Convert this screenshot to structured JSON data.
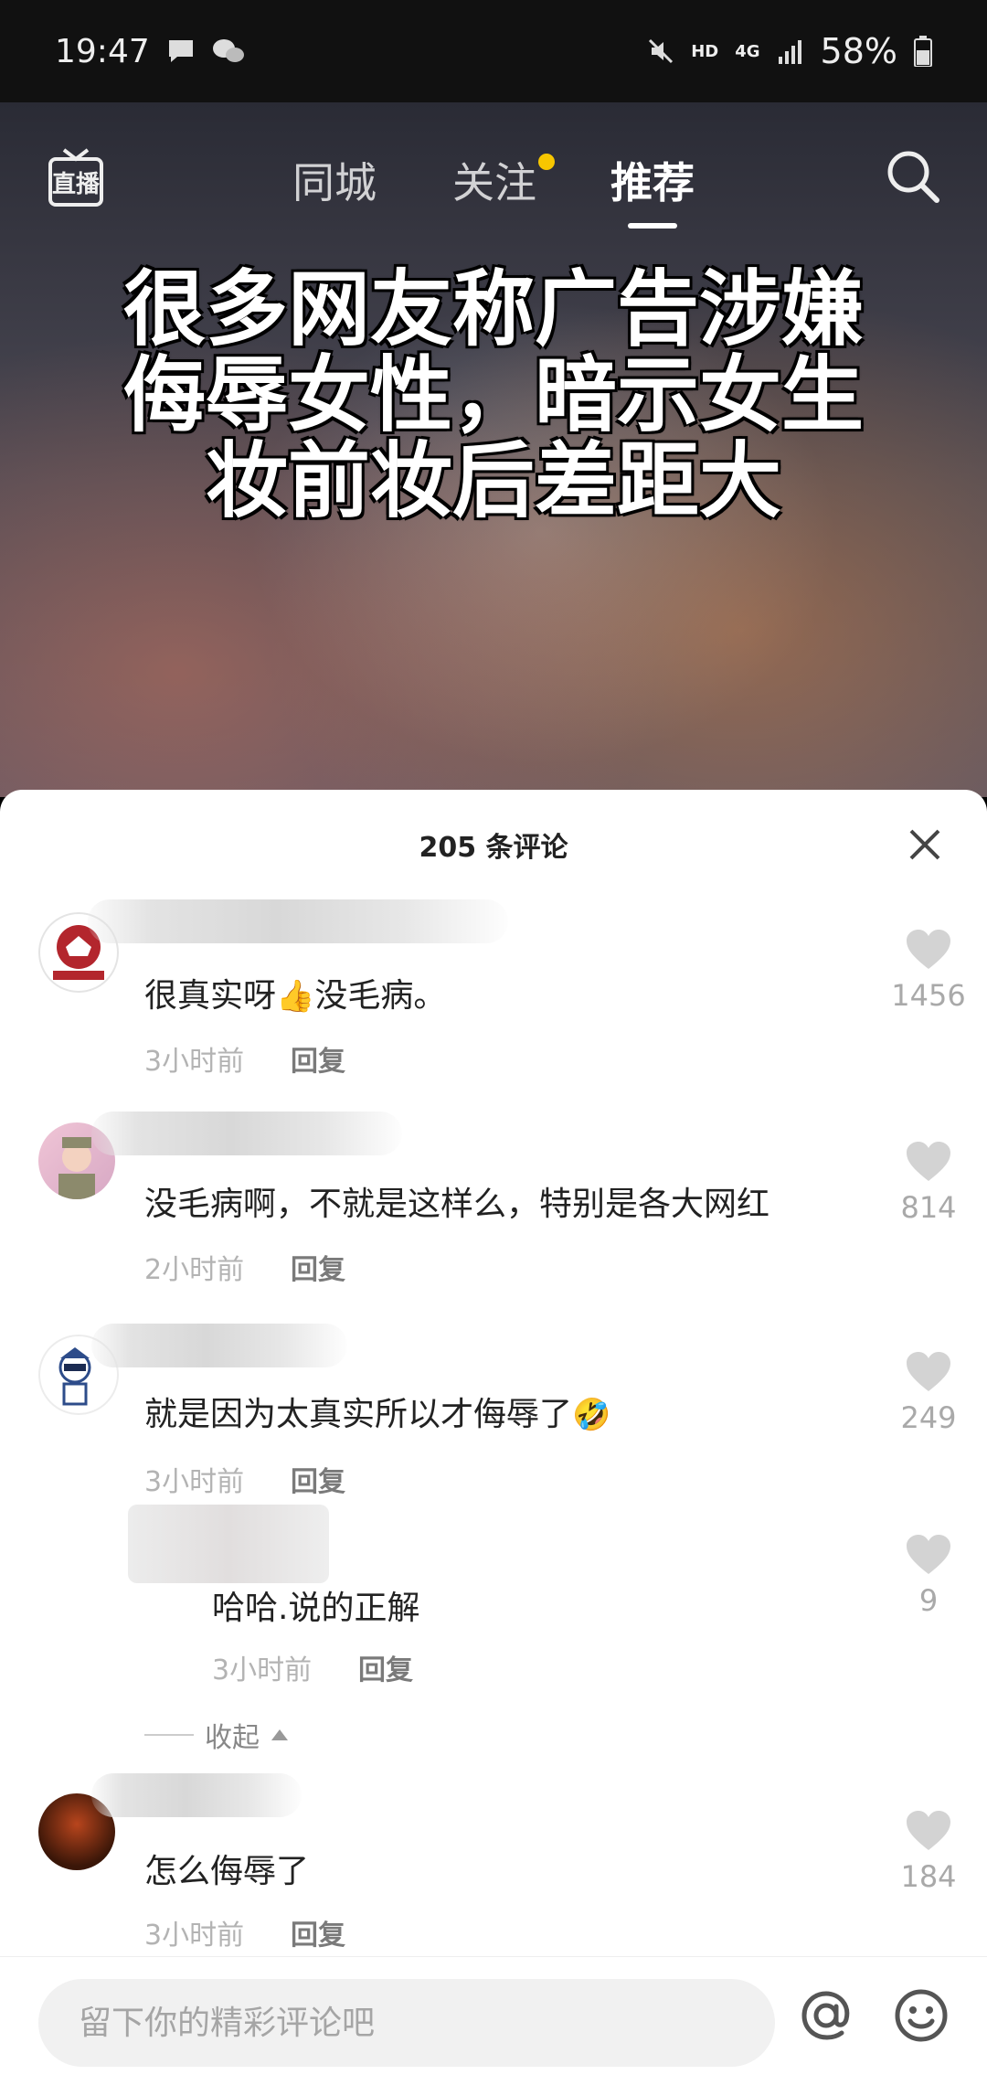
{
  "status_bar": {
    "time": "19:47",
    "network": "HD",
    "network_type": "4G",
    "battery": "58%"
  },
  "nav": {
    "live_label": "直播",
    "tabs": [
      {
        "label": "同城",
        "active": false
      },
      {
        "label": "关注",
        "active": false,
        "has_dot": true
      },
      {
        "label": "推荐",
        "active": true
      }
    ]
  },
  "video": {
    "caption_lines": [
      "很多网友称广告涉嫌",
      "侮辱女性，暗示女生",
      "妆前妆后差距大"
    ]
  },
  "comments_sheet": {
    "title": "205 条评论",
    "comments": [
      {
        "text_before": "很真实呀",
        "emoji": "👍",
        "text_after": "没毛病。",
        "time": "3小时前",
        "reply": "回复",
        "likes": "1456"
      },
      {
        "text": "没毛病啊，不就是这样么，特别是各大网红",
        "time": "2小时前",
        "reply": "回复",
        "likes": "814"
      },
      {
        "text": "就是因为太真实所以才侮辱了",
        "emoji": "🤣",
        "time": "3小时前",
        "reply": "回复",
        "likes": "249"
      },
      {
        "text": "哈哈.说的正解",
        "time": "3小时前",
        "reply": "回复",
        "likes": "9",
        "is_reply": true
      },
      {
        "text": "怎么侮辱了",
        "time": "3小时前",
        "reply": "回复",
        "likes": "184"
      }
    ],
    "collapse_label": "收起"
  },
  "input_bar": {
    "placeholder": "留下你的精彩评论吧"
  },
  "colors": {
    "accent_dot": "#f7c600",
    "sheet_bg": "#ffffff",
    "meta_text": "#b3b3b3"
  }
}
